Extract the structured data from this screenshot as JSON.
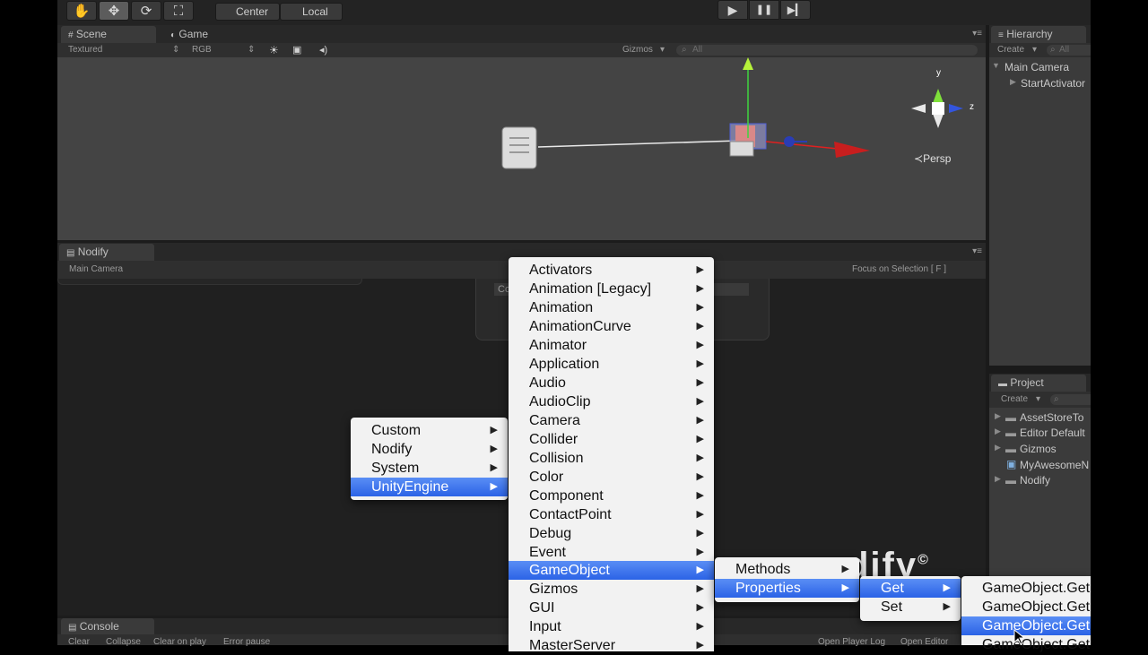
{
  "toolbar": {
    "tools": [
      {
        "icon": "hand-icon",
        "glyph": "✋"
      },
      {
        "icon": "move-icon",
        "glyph": "✥"
      },
      {
        "icon": "rotate-icon",
        "glyph": "⟳"
      },
      {
        "icon": "scale-icon",
        "glyph": "⛶"
      }
    ],
    "pivot": "Center",
    "space": "Local",
    "play_glyph": "▶",
    "pause_glyph": "❚❚",
    "step_glyph": "▶▎"
  },
  "scene_panel": {
    "tab_scene": "Scene",
    "tab_game": "Game",
    "render_mode": "Textured",
    "color_mode": "RGB",
    "gizmos": "Gizmos",
    "search_placeholder": "All",
    "axis_y": "y",
    "axis_z": "z",
    "persp": "Persp"
  },
  "nodify_panel": {
    "tab": "Nodify",
    "target": "Main Camera",
    "focus": "Focus on Selection [ F ]",
    "node_label": "Co",
    "watermark": "dify"
  },
  "hierarchy": {
    "tab": "Hierarchy",
    "create": "Create",
    "search_placeholder": "All",
    "items": [
      "Main Camera",
      "StartActivator"
    ]
  },
  "project": {
    "tab": "Project",
    "create": "Create",
    "items": [
      "AssetStoreTo",
      "Editor Default",
      "Gizmos",
      "MyAwesomeN",
      "Nodify"
    ]
  },
  "console": {
    "tab": "Console",
    "buttons": [
      "Clear",
      "Collapse",
      "Clear on play",
      "Error pause"
    ],
    "right_buttons": [
      "Open Player Log",
      "Open Editor"
    ]
  },
  "menu_root": {
    "items": [
      "Custom",
      "Nodify",
      "System",
      "UnityEngine"
    ],
    "selected": "UnityEngine"
  },
  "menu_unity": {
    "items": [
      "Activators",
      "Animation [Legacy]",
      "Animation",
      "AnimationCurve",
      "Animator",
      "Application",
      "Audio",
      "AudioClip",
      "Camera",
      "Collider",
      "Collision",
      "Color",
      "Component",
      "ContactPoint",
      "Debug",
      "Event",
      "GameObject",
      "Gizmos",
      "GUI",
      "Input",
      "MasterServer"
    ],
    "selected": "GameObject"
  },
  "menu_gameobject": {
    "items": [
      "Methods",
      "Properties"
    ],
    "selected": "Properties"
  },
  "menu_properties": {
    "items": [
      "Get",
      "Set"
    ],
    "selected": "Get"
  },
  "menu_get": {
    "items": [
      "GameObject.Get",
      "GameObject.Get",
      "GameObject.Get",
      "GameObject.Get"
    ],
    "selected_index": 2
  }
}
